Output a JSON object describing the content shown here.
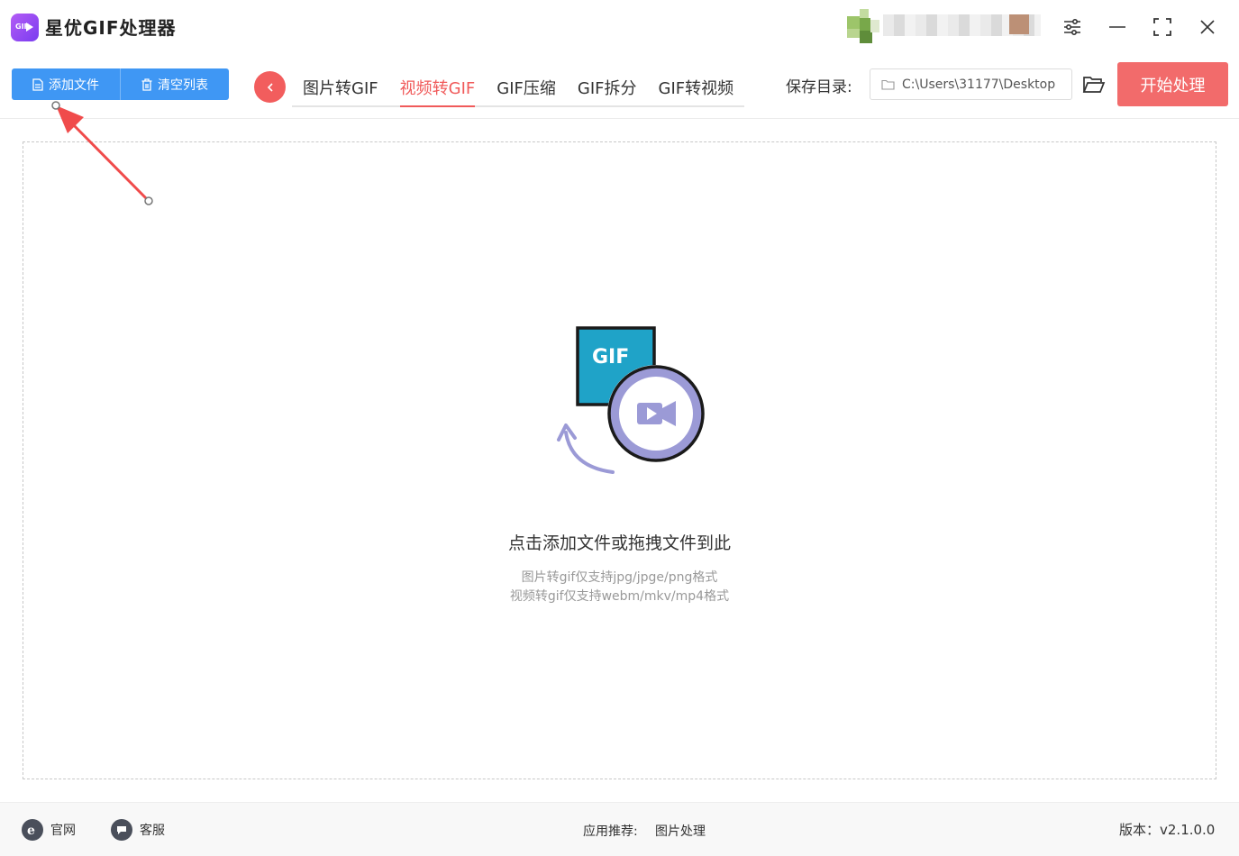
{
  "app": {
    "title": "星优GIF处理器",
    "logo_text": "GIF"
  },
  "toolbar": {
    "add_file_label": "添加文件",
    "clear_list_label": "清空列表",
    "tabs": [
      {
        "label": "图片转GIF",
        "active": false
      },
      {
        "label": "视频转GIF",
        "active": true
      },
      {
        "label": "GIF压缩",
        "active": false
      },
      {
        "label": "GIF拆分",
        "active": false
      },
      {
        "label": "GIF转视频",
        "active": false
      }
    ],
    "save_dir_label": "保存目录:",
    "save_dir_value": "C:\\Users\\31177\\Desktop",
    "start_label": "开始处理"
  },
  "dropzone": {
    "illustration_text": "GIF",
    "main_text": "点击添加文件或拖拽文件到此",
    "hint_line1": "图片转gif仅支持jpg/jpge/png格式",
    "hint_line2": "视频转gif仅支持webm/mkv/mp4格式"
  },
  "footer": {
    "website_label": "官网",
    "service_label": "客服",
    "recommend_label": "应用推荐:",
    "recommend_link": "图片处理",
    "version": "版本：v2.1.0.0"
  },
  "colors": {
    "primary_blue": "#3f97f4",
    "accent_red": "#f05a5a",
    "start_button": "#f26b6b",
    "illustration_cyan": "#1fa3c8",
    "illustration_purple": "#9b9ad6"
  },
  "icons": {
    "add_file": "document-icon",
    "clear_list": "trash-icon",
    "back": "chevron-left-icon",
    "folder_input": "folder-outline-icon",
    "folder_button": "folder-open-icon",
    "settings": "sliders-icon",
    "minimize": "minimize-icon",
    "maximize": "maximize-icon",
    "close": "close-icon",
    "website": "ie-browser-icon",
    "service": "chat-bubble-icon"
  }
}
